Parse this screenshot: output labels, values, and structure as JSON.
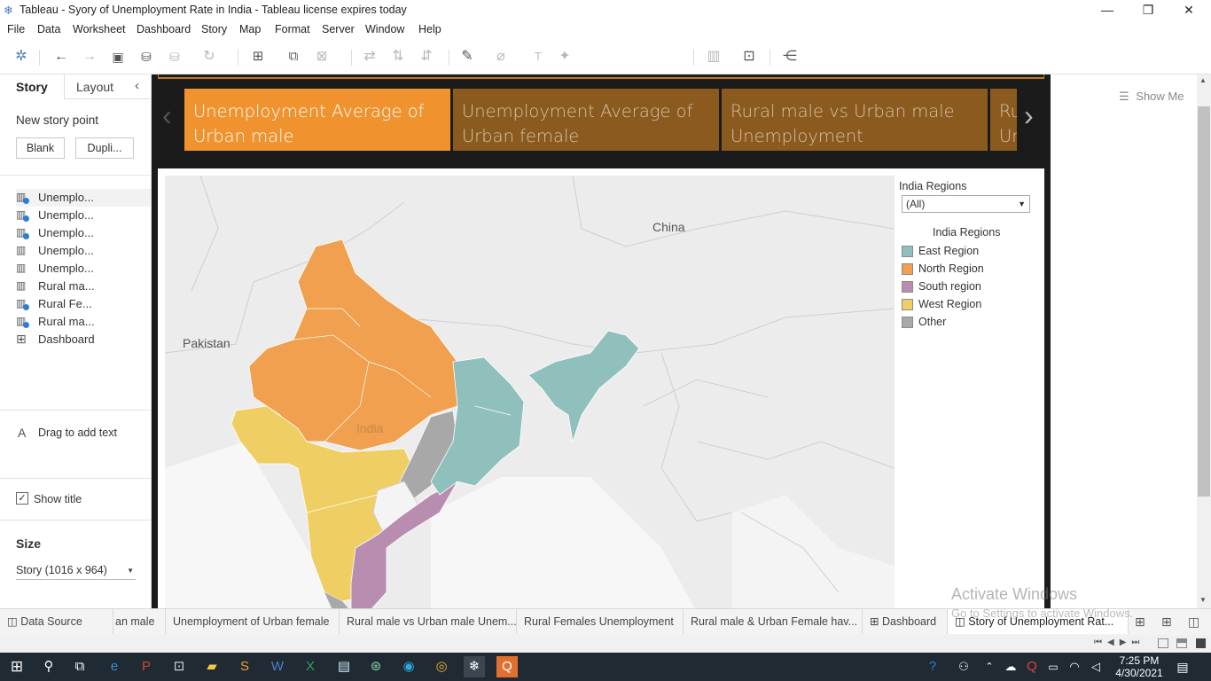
{
  "window": {
    "title": "Tableau - Syory of Unemployment Rate in India - Tableau license expires today",
    "controls": [
      "minimize",
      "restore",
      "close"
    ]
  },
  "menu": [
    "File",
    "Data",
    "Worksheet",
    "Dashboard",
    "Story",
    "Map",
    "Format",
    "Server",
    "Window",
    "Help"
  ],
  "toolbar": {
    "show_me": "Show Me"
  },
  "left_pane": {
    "tabs": [
      "Story",
      "Layout"
    ],
    "new_story_point": "New story point",
    "blank_button": "Blank",
    "duplicate_button": "Dupli...",
    "sheets": [
      {
        "label": "Unemplo...",
        "kind": "sheet",
        "in_story": true
      },
      {
        "label": "Unemplo...",
        "kind": "sheet",
        "in_story": true
      },
      {
        "label": "Unemplo...",
        "kind": "sheet",
        "in_story": true
      },
      {
        "label": "Unemplo...",
        "kind": "sheet",
        "in_story": false
      },
      {
        "label": "Unemplo...",
        "kind": "sheet",
        "in_story": false
      },
      {
        "label": "Rural ma...",
        "kind": "sheet",
        "in_story": false
      },
      {
        "label": "Rural Fe...",
        "kind": "sheet",
        "in_story": true
      },
      {
        "label": "Rural ma...",
        "kind": "sheet",
        "in_story": true
      },
      {
        "label": "Dashboard",
        "kind": "dashboard",
        "in_story": false
      }
    ],
    "drag_text": "Drag to add text",
    "show_title": "Show title",
    "show_title_checked": true,
    "size_label": "Size",
    "size_value": "Story (1016 x 964)"
  },
  "story": {
    "points": [
      {
        "text": "Unemployment Average of Urban male",
        "active": true
      },
      {
        "text": "Unemployment Average of Urban female",
        "active": false
      },
      {
        "text": "Rural male vs Urban male Unemployment",
        "active": false
      },
      {
        "text": "Ru Ur",
        "active": false
      }
    ],
    "colors": {
      "active": "#f0922e",
      "inactive": "#8a5a1f"
    }
  },
  "map": {
    "labels": {
      "china": "China",
      "pakistan": "Pakistan",
      "india": "India"
    },
    "region_colors": {
      "east": "#8fc0bb",
      "north": "#f0a04e",
      "south": "#b98db0",
      "west": "#efcf63",
      "other": "#a8a8a8"
    }
  },
  "filter": {
    "title": "India Regions",
    "value": "(All)"
  },
  "legend": {
    "title": "India Regions",
    "items": [
      {
        "label": "East Region",
        "color": "#8fc0bb"
      },
      {
        "label": "North Region",
        "color": "#f0a04e"
      },
      {
        "label": "South region",
        "color": "#b98db0"
      },
      {
        "label": "West Region",
        "color": "#efcf63"
      },
      {
        "label": "Other",
        "color": "#a8a8a8"
      }
    ]
  },
  "sheet_tabs": [
    {
      "label": "Data Source",
      "active": false
    },
    {
      "label": "an male",
      "active": false
    },
    {
      "label": "Unemployment of Urban female",
      "active": false
    },
    {
      "label": "Rural male vs Urban male Unem...",
      "active": false
    },
    {
      "label": "Rural Females Unemployment",
      "active": false
    },
    {
      "label": "Rural male & Urban Female hav...",
      "active": false
    },
    {
      "label": "Dashboard",
      "active": false
    },
    {
      "label": "Story of Unemployment Rat...",
      "active": true
    }
  ],
  "watermark": {
    "line1": "Activate Windows",
    "line2": "Go to Settings to activate Windows."
  },
  "taskbar": {
    "time": "7:25 PM",
    "date": "4/30/2021"
  }
}
